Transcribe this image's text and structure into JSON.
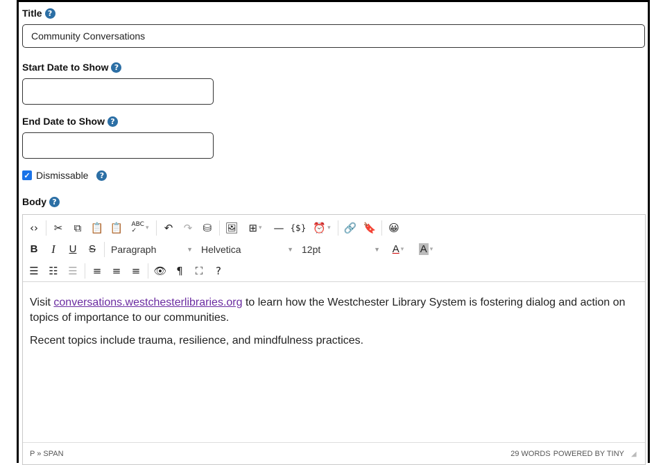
{
  "form": {
    "title_label": "Title",
    "title_value": "Community Conversations",
    "start_date_label": "Start Date to Show",
    "start_date_value": "",
    "end_date_label": "End Date to Show",
    "end_date_value": "",
    "dismissable_label": "Dismissable",
    "dismissable_checked": true,
    "body_label": "Body",
    "help_glyph": "?"
  },
  "toolbar": {
    "row1": [
      "source-code",
      "cut",
      "copy",
      "paste",
      "paste-text",
      "spellcheck",
      "undo",
      "redo",
      "find-replace",
      "image",
      "table",
      "horizontal-rule",
      "template",
      "insert-datetime",
      "link",
      "bookmark",
      "emoticons"
    ],
    "bold_label": "B",
    "italic_label": "I",
    "underline_label": "U",
    "strike_label": "S",
    "block_format": "Paragraph",
    "font_family": "Helvetica",
    "font_size": "12pt",
    "text_color_label": "A",
    "bg_color_label": "A"
  },
  "content": {
    "p1_before": "Visit ",
    "p1_link": "conversations.westchesterlibraries.org",
    "p1_after": " to learn how the Westchester Library System is fostering dialog and action on topics of importance to our communities.",
    "p2": "Recent topics include trauma, resilience, and mindfulness practices."
  },
  "statusbar": {
    "path": "P » SPAN",
    "word_count": "29 WORDS",
    "powered_by": "POWERED BY TINY"
  },
  "colors": {
    "help_icon": "#2c6fa5",
    "checkbox": "#1a73e8",
    "link": "#6a2ba0"
  }
}
